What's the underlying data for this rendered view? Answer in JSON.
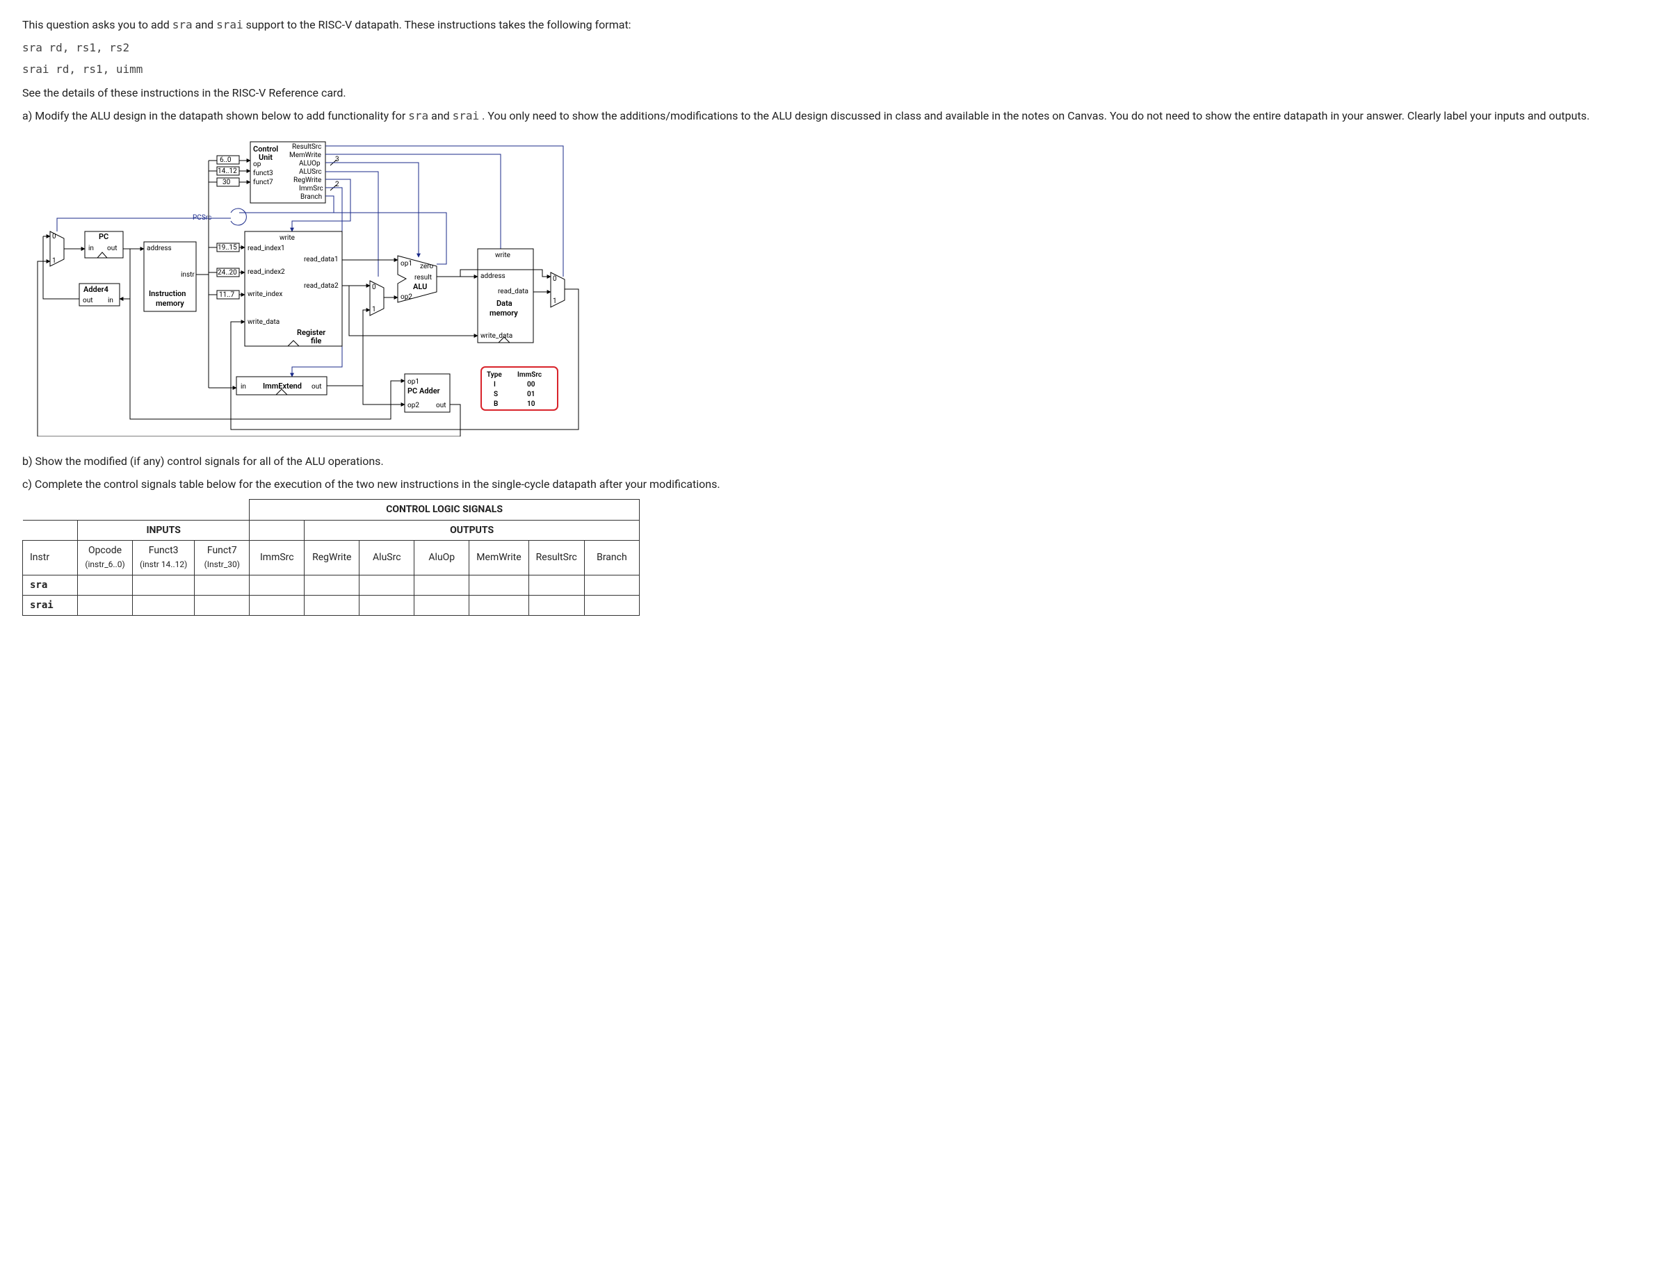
{
  "intro": {
    "p1_a": "This question asks you to add ",
    "p1_b": " and ",
    "p1_c": " support to the RISC-V datapath. These instructions takes the following format:",
    "code_sra": "sra",
    "code_srai": "srai",
    "code_line1": "sra rd, rs1, rs2",
    "code_line2": "srai rd, rs1, uimm",
    "p2": "See the details of these instructions in the RISC-V Reference card.",
    "p3_a": "a) Modify the ALU design in the datapath shown below to add functionality for ",
    "p3_b": " and ",
    "p3_c": ". You only need to show the additions/modifications to the ALU design discussed in class and available in the notes on Canvas. You do not need to show the entire datapath in your answer. Clearly label your inputs and outputs."
  },
  "diagram": {
    "pcsrc": "PCSrc",
    "pc_block": "PC",
    "pc_in": "in",
    "pc_out": "out",
    "adder4": "Adder4",
    "adder_out": "out",
    "adder_in": "in",
    "imem_top": "Instruction",
    "imem_bot": "memory",
    "imem_addr": "address",
    "imem_instr": "instr",
    "cu_title1": "Control",
    "cu_title2": "Unit",
    "cu_op": "op",
    "cu_f3": "funct3",
    "cu_f7": "funct7",
    "cu_resultsrc": "ResultSrc",
    "cu_memwrite": "MemWrite",
    "cu_aluop": "ALUOp",
    "cu_alusrc": "ALUSrc",
    "cu_regwrite": "RegWrite",
    "cu_immsrc": "ImmSrc",
    "cu_branch": "Branch",
    "bits_6_0": "6..0",
    "bits_14_12": "14..12",
    "bits_30": "30",
    "bits_19_15": "19..15",
    "bits_24_20": "24..20",
    "bits_11_7": "11..7",
    "rf": {
      "write": "write",
      "ri1": "read_index1",
      "rd1": "read_data1",
      "ri2": "read_index2",
      "rd2": "read_data2",
      "wi": "write_index",
      "wd": "write_data",
      "t1": "Register",
      "t2": "file"
    },
    "imme_in": "in",
    "imme_t": "ImmExtend",
    "imme_out": "out",
    "alu": {
      "t": "ALU",
      "op1": "op1",
      "op2": "op2",
      "zero": "zero",
      "result": "result"
    },
    "dmem": {
      "write": "write",
      "addr": "address",
      "rd": "read_data",
      "t1": "Data",
      "t2": "memory",
      "wd": "write_data"
    },
    "pcadder": {
      "op1": "op1",
      "t": "PC Adder",
      "op2": "op2",
      "out": "out"
    },
    "immsrc_tbl": {
      "h1": "Type",
      "h2": "ImmSrc",
      "r1a": "I",
      "r1b": "00",
      "r2a": "S",
      "r2b": "01",
      "r3a": "B",
      "r3b": "10"
    },
    "mux": {
      "z": "0",
      "o": "1"
    },
    "bus3": "3",
    "bus2": "2"
  },
  "after": {
    "b": "b) Show the modified (if any) control signals for all of the ALU operations.",
    "c": "c) Complete the control signals table below for the execution of the two new instructions in the single-cycle datapath after your modifications."
  },
  "table": {
    "title": "CONTROL LOGIC SIGNALS",
    "inputs": "INPUTS",
    "outputs": "OUTPUTS",
    "cols": {
      "instr": "Instr",
      "opcode": "Opcode",
      "opcode_sub": "(instr_6..0)",
      "funct3": "Funct3",
      "funct3_sub": "(instr 14..12)",
      "funct7": "Funct7",
      "funct7_sub": "(Instr_30)",
      "immsrc": "ImmSrc",
      "regwrite": "RegWrite",
      "alusrc": "AluSrc",
      "aluop": "AluOp",
      "memwrite": "MemWrite",
      "resultsrc": "ResultSrc",
      "branch": "Branch"
    },
    "rows": {
      "sra": "sra",
      "srai": "srai"
    }
  }
}
